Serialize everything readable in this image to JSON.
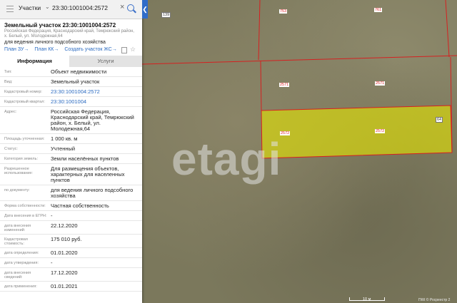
{
  "search": {
    "type_label": "Участки",
    "query": "23:30:1001004:2572"
  },
  "object": {
    "title": "Земельный участок 23:30:1001004:2572",
    "address": "Российская Федерация, Краснодарский край, Темрюкский район, х. Белый, ул. Молодежная,64",
    "purpose": "для ведения личного подсобного хозяйства"
  },
  "links": [
    "План ЗУ",
    "План КК",
    "Создать участок ЖС"
  ],
  "tabs": [
    "Информация",
    "Услуги"
  ],
  "rows": [
    {
      "label": "Тип:",
      "value": "Объект недвижимости"
    },
    {
      "label": "Вид:",
      "value": "Земельный участок"
    },
    {
      "label": "Кадастровый номер:",
      "value": "23:30:1001004:2572"
    },
    {
      "label": "Кадастровый квартал:",
      "value": "23:30:1001004"
    },
    {
      "label": "Адрес:",
      "value": "Российская Федерация, Краснодарский край, Темрюкский район, х. Белый, ул. Молодежная,64"
    },
    {
      "label": "Площадь уточненная:",
      "value": "1 000 кв. м"
    },
    {
      "label": "Статус:",
      "value": "Учтенный"
    },
    {
      "label": "Категория земель:",
      "value": "Земли населённых пунктов"
    },
    {
      "label": "Разрешенное использование:",
      "value": "Для размещения объектов, характерных для населенных пунктов"
    },
    {
      "label": "по документу:",
      "value": "для ведения личного подсобного хозяйства"
    },
    {
      "label": "Форма собственности:",
      "value": "Частная собственность"
    },
    {
      "label": "Дата внесения в ЕГРН:",
      "value": "-"
    },
    {
      "label": "дата внесения изменений:",
      "value": "22.12.2020"
    },
    {
      "label": "Кадастровая стоимость:",
      "value": "175 010 руб."
    },
    {
      "label": "дата определения:",
      "value": "01.01.2020"
    },
    {
      "label": "дата утверждения:",
      "value": "-"
    },
    {
      "label": "дата внесения сведений:",
      "value": "17.12.2020"
    },
    {
      "label": "дата применения:",
      "value": "01.01.2021"
    }
  ],
  "map": {
    "labels": [
      "139",
      "753",
      "761",
      "2571",
      "2571",
      "2572",
      "2572",
      "64"
    ],
    "watermark": "etagi",
    "scale": "10 м",
    "copyright": "ПКК © Росреестр 2"
  },
  "colors": {
    "parcel_fill": "#e6e600",
    "boundary": "#d62020",
    "link": "#2a6ac0",
    "accent": "#2f6cc9"
  }
}
